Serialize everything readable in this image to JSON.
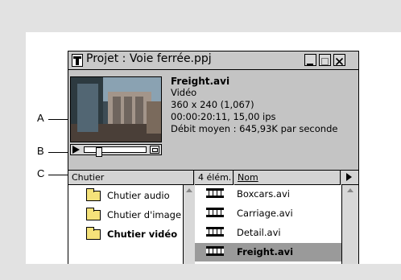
{
  "window": {
    "title": "Projet : Voie ferrée.ppj"
  },
  "preview": {
    "file_name": "Freight.avi",
    "type": "Vidéo",
    "dimensions": "360 x 240 (1,067)",
    "duration": "00:00:20:11, 15,00 ips",
    "data_rate": "Débit moyen : 645,93K par seconde"
  },
  "callouts": {
    "a": "A",
    "b": "B",
    "c": "C"
  },
  "list_header": {
    "bin_column": "Chutier",
    "count": "4 élém.",
    "name_column": "Nom"
  },
  "bins": [
    {
      "label": "Chutier audio",
      "bold": false
    },
    {
      "label": "Chutier d'image",
      "bold": false
    },
    {
      "label": "Chutier vidéo",
      "bold": true
    }
  ],
  "files": [
    {
      "label": "Boxcars.avi",
      "selected": false
    },
    {
      "label": "Carriage.avi",
      "selected": false
    },
    {
      "label": "Detail.avi",
      "selected": false
    },
    {
      "label": "Freight.avi",
      "selected": true
    }
  ]
}
